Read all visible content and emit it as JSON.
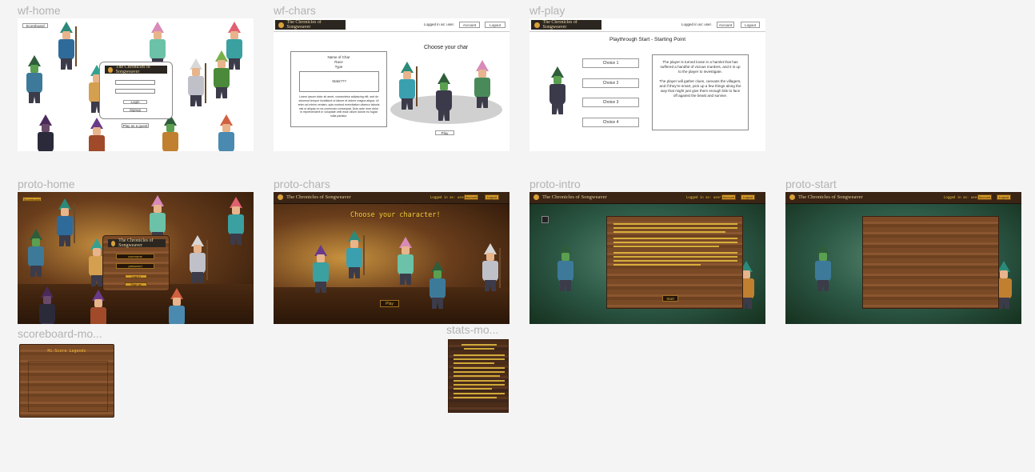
{
  "frames": {
    "wf_home": {
      "label": "wf-home",
      "scoreboard_label": "Scoreboard",
      "game_title": "The Chronicles of Songweaver",
      "login_label": "Login",
      "signup_label": "Signup",
      "guest_label": "Play as a guest"
    },
    "wf_chars": {
      "label": "wf-chars",
      "game_title": "The Chronicles of Songweaver",
      "logged_in_text": "Logged in as: user.",
      "account_label": "Account",
      "logout_label": "Logout",
      "char_info_lines": [
        "Name of Char",
        "Race",
        "Type"
      ],
      "stats_label": "Stats???",
      "lorem": "Lorem ipsum dolor sit amet, consectetur adipiscing elit, sed do eiusmod tempor incididunt ut labore et dolore magna aliqua. Ut enim ad minim veniam, quis nostrud exercitation ullamco laboris nisi ut aliquip ex ea commodo consequat. Duis aute irure dolor in reprehenderit in voluptate velit esse cillum dolore eu fugiat nulla pariatur.",
      "choose_heading": "Choose your char",
      "play_label": "Play"
    },
    "wf_play": {
      "label": "wf-play",
      "game_title": "The Chronicles of Songweaver",
      "logged_in_text": "Logged in as: user.",
      "account_label": "Account",
      "logout_label": "Logout",
      "heading": "Playthrough Start - Starting Point",
      "choices": [
        "Choice 1",
        "Choice 2",
        "Choice 3",
        "Choice 4"
      ],
      "story_p1": "The player is turned loose in a hamlet that has suffered a handful of vicious murders, and it is up to the player to investigate.",
      "story_p2": "The player will gather clues, canvass the villagers, and if they're smart, pick up a few things along the way that might just give them enough bits to face off against the beast and survive."
    },
    "proto_home": {
      "label": "proto-home",
      "scoreboard_label": "Scoreboard",
      "game_title": "The Chronicles of Songweaver",
      "username_placeholder": "username",
      "password_placeholder": "password",
      "login_label": "Log In",
      "signup_label": "Sign up"
    },
    "proto_chars": {
      "label": "proto-chars",
      "game_title": "The Chronicles of Songweaver",
      "logged_in_text": "Logged in as: user.",
      "account_label": "Account",
      "logout_label": "Logout",
      "heading": "Choose your character!",
      "play_label": "Play"
    },
    "proto_intro": {
      "label": "proto-intro",
      "game_title": "The Chronicles of Songweaver",
      "logged_in_text": "Logged in as: user.",
      "account_label": "Account",
      "logout_label": "Logout",
      "start_label": "Start"
    },
    "proto_start": {
      "label": "proto-start",
      "game_title": "The Chronicles of Songweaver",
      "logged_in_text": "Logged in as: user.",
      "account_label": "Account",
      "logout_label": "Logout"
    },
    "scoreboard_modal": {
      "label": "scoreboard-mo...",
      "heading": "Hi-Score Legends"
    },
    "stats_modal": {
      "label": "stats-mo..."
    }
  },
  "colors": {
    "canvas_bg": "#f4f4f4",
    "label": "#b3b3b3",
    "gold": "#d49a2a",
    "wood_dark": "#3a2414"
  }
}
